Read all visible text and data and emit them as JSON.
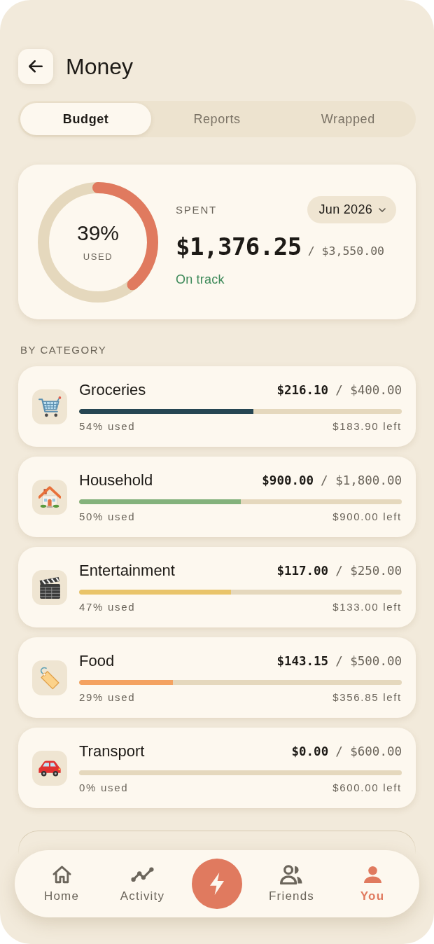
{
  "header": {
    "title": "Money"
  },
  "tabs": [
    {
      "label": "Budget",
      "selected": true
    },
    {
      "label": "Reports",
      "selected": false
    },
    {
      "label": "Wrapped",
      "selected": false
    }
  ],
  "summary": {
    "percent": "39%",
    "percent_caption": "USED",
    "level": 0.39,
    "label": "SPENT",
    "period": "Jun 2026",
    "spent": "$1,376.25",
    "of_budget": "/ $3,550.00",
    "status": "On track"
  },
  "section_title": "BY CATEGORY",
  "categories": [
    {
      "name": "Groceries",
      "spent": "$216.10",
      "of_budget": "/ $400.00",
      "level": 0.54,
      "color": "#264653",
      "used": "54% used",
      "left": "$183.90 left"
    },
    {
      "name": "Household",
      "spent": "$900.00",
      "of_budget": "/ $1,800.00",
      "level": 0.5,
      "color": "#84b27c",
      "used": "50% used",
      "left": "$900.00 left"
    },
    {
      "name": "Entertainment",
      "spent": "$117.00",
      "of_budget": "/ $250.00",
      "level": 0.47,
      "color": "#e9c46a",
      "used": "47% used",
      "left": "$133.00 left"
    },
    {
      "name": "Food",
      "spent": "$143.15",
      "of_budget": "/ $500.00",
      "level": 0.29,
      "color": "#f4a261",
      "used": "29% used",
      "left": "$356.85 left"
    },
    {
      "name": "Transport",
      "spent": "$0.00",
      "of_budget": "/ $600.00",
      "level": 0,
      "used": "0% used",
      "left": "$600.00 left"
    }
  ],
  "nav": [
    {
      "kind": "tab",
      "label": "Home",
      "selected": false
    },
    {
      "kind": "tab",
      "label": "Activity",
      "selected": false
    },
    {
      "kind": "action"
    },
    {
      "kind": "tab",
      "label": "Friends",
      "selected": false
    },
    {
      "kind": "tab",
      "label": "You",
      "selected": true
    }
  ]
}
